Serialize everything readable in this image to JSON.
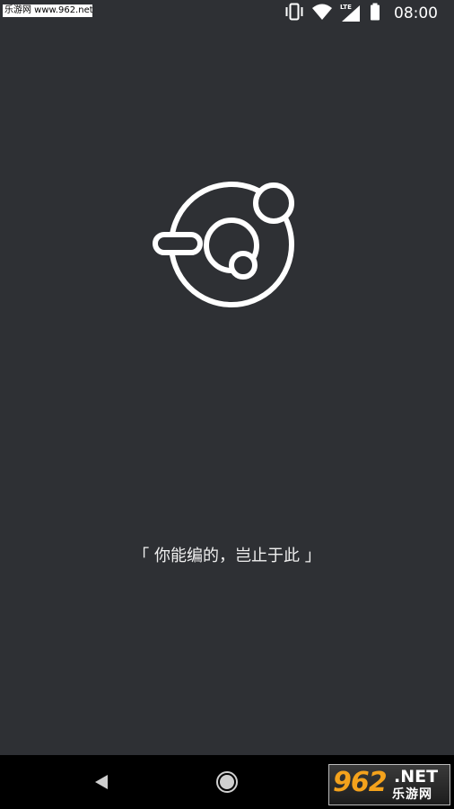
{
  "status_bar": {
    "watermark_text": "乐游网 www.962.net",
    "network_label": "LTE",
    "time": "08:00",
    "icons": [
      "vibrate-icon",
      "wifi-icon",
      "signal-icon",
      "battery-icon"
    ]
  },
  "splash": {
    "logo_icon": "planet-orbit-logo-icon",
    "slogan": "「 你能编的，岂止于此 」"
  },
  "nav_bar": {
    "icons": [
      "back-icon",
      "home-icon"
    ]
  },
  "watermark_logo": {
    "number": "962",
    "suffix": ".NET",
    "chinese": "乐游网"
  },
  "colors": {
    "background": "#2e3034",
    "foreground": "#ffffff",
    "nav_background": "#000000",
    "watermark_accent": "#f4a21c"
  }
}
